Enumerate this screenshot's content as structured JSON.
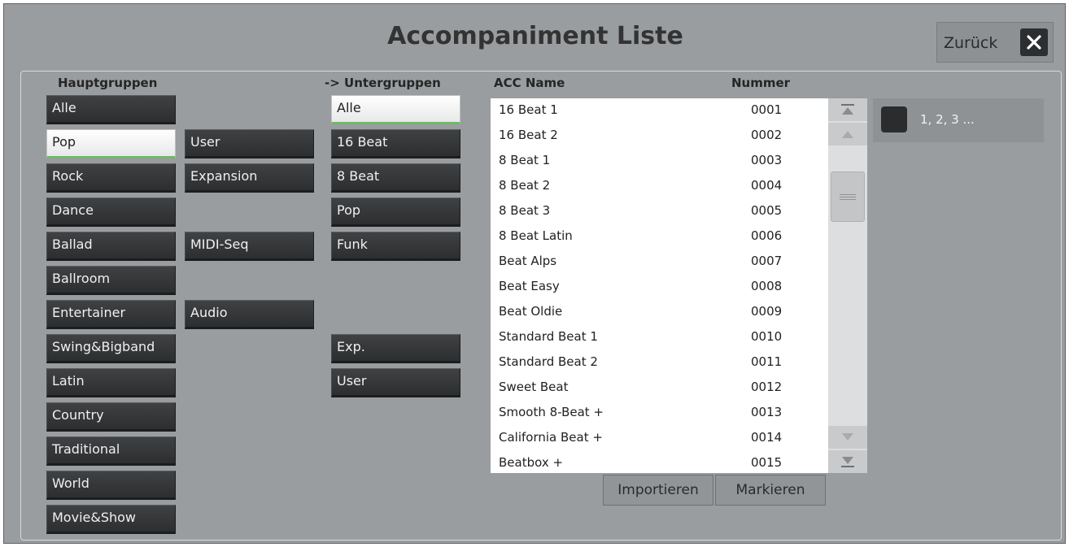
{
  "title": "Accompaniment Liste",
  "back_label": "Zurück",
  "headers": {
    "hauptgruppen": "Hauptgruppen",
    "untergruppen": "-> Untergruppen",
    "acc_name": "ACC Name",
    "nummer": "Nummer"
  },
  "hauptgruppen": [
    "Alle",
    "Pop",
    "Rock",
    "Dance",
    "Ballad",
    "Ballroom",
    "Entertainer",
    "Swing&Bigband",
    "Latin",
    "Country",
    "Traditional",
    "World",
    "Movie&Show"
  ],
  "hauptgruppen_selected": "Pop",
  "sources": [
    "User",
    "Expansion",
    "MIDI-Seq",
    "Audio"
  ],
  "untergruppen": [
    "Alle",
    "16 Beat",
    "8 Beat",
    "Pop",
    "Funk",
    "Exp.",
    "User"
  ],
  "untergruppen_selected": "Alle",
  "rows": [
    {
      "name": "16 Beat 1",
      "nr": "0001"
    },
    {
      "name": "16 Beat 2",
      "nr": "0002"
    },
    {
      "name": "8 Beat 1",
      "nr": "0003"
    },
    {
      "name": "8 Beat 2",
      "nr": "0004"
    },
    {
      "name": "8 Beat 3",
      "nr": "0005"
    },
    {
      "name": "8 Beat Latin",
      "nr": "0006"
    },
    {
      "name": "Beat Alps",
      "nr": "0007"
    },
    {
      "name": "Beat Easy",
      "nr": "0008"
    },
    {
      "name": "Beat Oldie",
      "nr": "0009"
    },
    {
      "name": "Standard Beat 1",
      "nr": "0010"
    },
    {
      "name": "Standard Beat 2",
      "nr": "0011"
    },
    {
      "name": "Sweet Beat",
      "nr": "0012"
    },
    {
      "name": "Smooth 8-Beat +",
      "nr": "0013"
    },
    {
      "name": "California Beat +",
      "nr": "0014"
    },
    {
      "name": "Beatbox +",
      "nr": "0015"
    }
  ],
  "actions": {
    "import": "Importieren",
    "mark": "Markieren"
  },
  "option_label": "1, 2, 3 ...",
  "icons": {
    "close": "close-icon",
    "scroll_top": "scroll-top-icon",
    "scroll_up": "scroll-up-icon",
    "scroll_down": "scroll-down-icon",
    "scroll_bottom": "scroll-bottom-icon"
  },
  "colors": {
    "selection_accent": "#6fb86a"
  }
}
